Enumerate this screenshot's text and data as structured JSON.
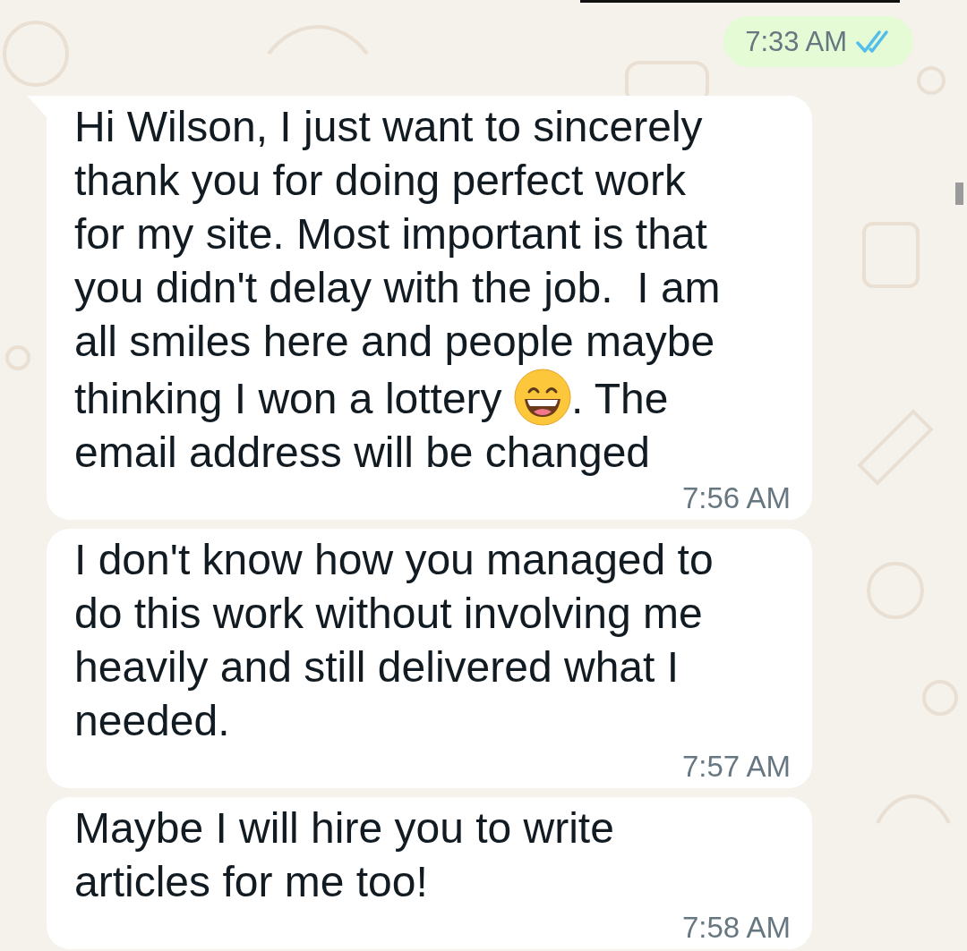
{
  "outgoing": {
    "time": "7:33 AM",
    "read": true
  },
  "messages": [
    {
      "tail": true,
      "time": "7:56 AM",
      "segments": [
        {
          "kind": "text",
          "text": "Hi Wilson, I just want to sincerely thank you for doing perfect work for my site. Most important is that you didn't delay with the job.  I am all smiles here and people maybe"
        },
        {
          "kind": "inline",
          "text": "thinking I won a lottery "
        },
        {
          "kind": "emoji"
        },
        {
          "kind": "inline",
          "text": ". The"
        },
        {
          "kind": "text",
          "text": "email address will be changed"
        }
      ]
    },
    {
      "tail": false,
      "time": "7:57 AM",
      "segments": [
        {
          "kind": "text",
          "text": "I don't know how you managed to do this work without involving me heavily and still delivered what I needed."
        }
      ]
    },
    {
      "tail": false,
      "time": "7:58 AM",
      "segments": [
        {
          "kind": "text",
          "text": "Maybe I will hire you to write articles for me too!"
        }
      ]
    }
  ]
}
